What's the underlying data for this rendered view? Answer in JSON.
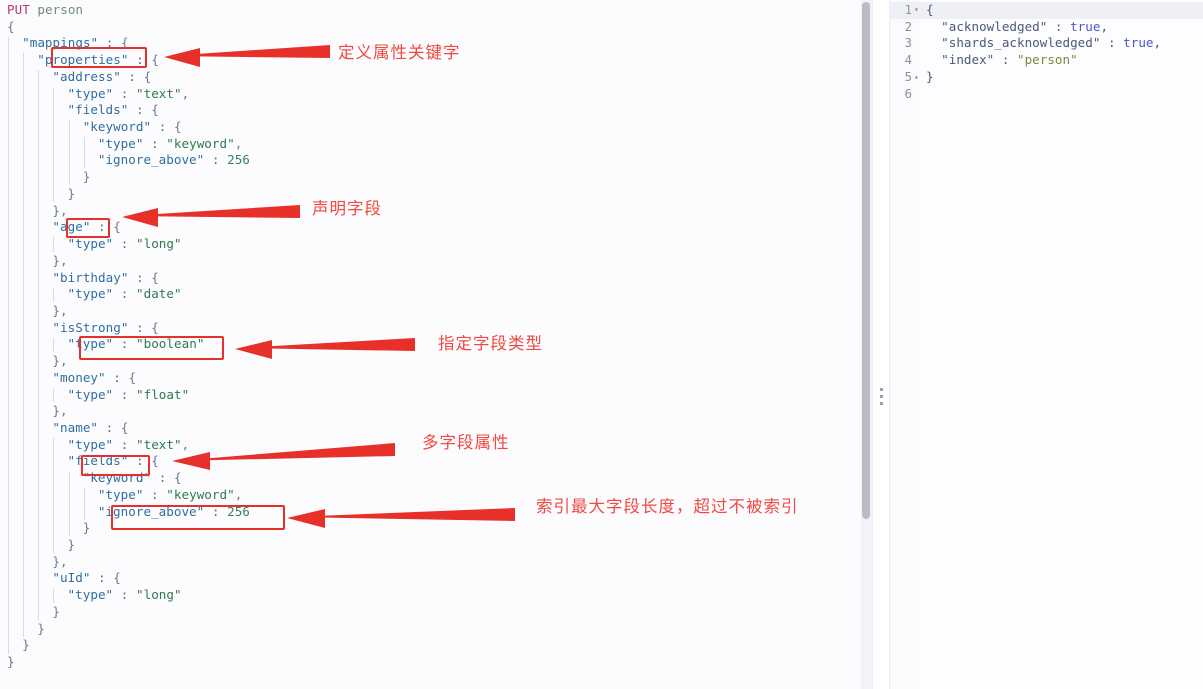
{
  "app": {
    "name": "kibana-dev-tools-console",
    "accent_red": "#e8302a",
    "label_red": "#ef4a42"
  },
  "request_editor": {
    "name": "console-request-editor",
    "method": "PUT",
    "path": "person",
    "lines": [
      {
        "indent": 0,
        "text": "PUT person",
        "kind": "request-line"
      },
      {
        "indent": 0,
        "text": "{"
      },
      {
        "indent": 1,
        "text": "\"mappings\" : {"
      },
      {
        "indent": 2,
        "text": "\"properties\" : {"
      },
      {
        "indent": 3,
        "text": "\"address\" : {"
      },
      {
        "indent": 4,
        "text": "\"type\" : \"text\","
      },
      {
        "indent": 4,
        "text": "\"fields\" : {"
      },
      {
        "indent": 5,
        "text": "\"keyword\" : {"
      },
      {
        "indent": 6,
        "text": "\"type\" : \"keyword\","
      },
      {
        "indent": 6,
        "text": "\"ignore_above\" : 256"
      },
      {
        "indent": 5,
        "text": "}"
      },
      {
        "indent": 4,
        "text": "}"
      },
      {
        "indent": 3,
        "text": "},"
      },
      {
        "indent": 3,
        "text": "\"age\" : {"
      },
      {
        "indent": 4,
        "text": "\"type\" : \"long\""
      },
      {
        "indent": 3,
        "text": "},"
      },
      {
        "indent": 3,
        "text": "\"birthday\" : {"
      },
      {
        "indent": 4,
        "text": "\"type\" : \"date\""
      },
      {
        "indent": 3,
        "text": "},"
      },
      {
        "indent": 3,
        "text": "\"isStrong\" : {"
      },
      {
        "indent": 4,
        "text": "\"type\" : \"boolean\""
      },
      {
        "indent": 3,
        "text": "},"
      },
      {
        "indent": 3,
        "text": "\"money\" : {"
      },
      {
        "indent": 4,
        "text": "\"type\" : \"float\""
      },
      {
        "indent": 3,
        "text": "},"
      },
      {
        "indent": 3,
        "text": "\"name\" : {"
      },
      {
        "indent": 4,
        "text": "\"type\" : \"text\","
      },
      {
        "indent": 4,
        "text": "\"fields\" : {"
      },
      {
        "indent": 5,
        "text": "\"keyword\" : {"
      },
      {
        "indent": 6,
        "text": "\"type\" : \"keyword\","
      },
      {
        "indent": 6,
        "text": "\"ignore_above\" : 256"
      },
      {
        "indent": 5,
        "text": "}"
      },
      {
        "indent": 4,
        "text": "}"
      },
      {
        "indent": 3,
        "text": "},"
      },
      {
        "indent": 3,
        "text": "\"uId\" : {"
      },
      {
        "indent": 4,
        "text": "\"type\" : \"long\""
      },
      {
        "indent": 3,
        "text": "}"
      },
      {
        "indent": 2,
        "text": "}"
      },
      {
        "indent": 1,
        "text": "}"
      },
      {
        "indent": 0,
        "text": "}"
      }
    ]
  },
  "response_panel": {
    "name": "console-response-output",
    "lines": [
      {
        "number": "1",
        "fold": "▾",
        "text": "{"
      },
      {
        "number": "2",
        "fold": "",
        "text": "  \"acknowledged\" : true,"
      },
      {
        "number": "3",
        "fold": "",
        "text": "  \"shards_acknowledged\" : true,"
      },
      {
        "number": "4",
        "fold": "",
        "text": "  \"index\" : \"person\""
      },
      {
        "number": "5",
        "fold": "▴",
        "text": "}"
      },
      {
        "number": "6",
        "fold": "",
        "text": ""
      }
    ],
    "values": {
      "acknowledged": "true",
      "shards_acknowledged": "true",
      "index": "person"
    }
  },
  "annotations": [
    {
      "id": "anno-properties",
      "label": "定义属性关键字",
      "target": "\"properties\""
    },
    {
      "id": "anno-age",
      "label": "声明字段",
      "target": "\"age\""
    },
    {
      "id": "anno-type-boolean",
      "label": "指定字段类型",
      "target": "\"type\" : \"boolean\""
    },
    {
      "id": "anno-fields",
      "label": "多字段属性",
      "target": "\"fields\""
    },
    {
      "id": "anno-ignore-above",
      "label": "索引最大字段长度，超过不被索引",
      "target": "\"ignore_above\" : 256"
    }
  ],
  "splitter": {
    "name": "pane-splitter",
    "grip": "drag-handle-icon"
  },
  "scrollbar": {
    "name": "editor-vertical-scrollbar"
  }
}
